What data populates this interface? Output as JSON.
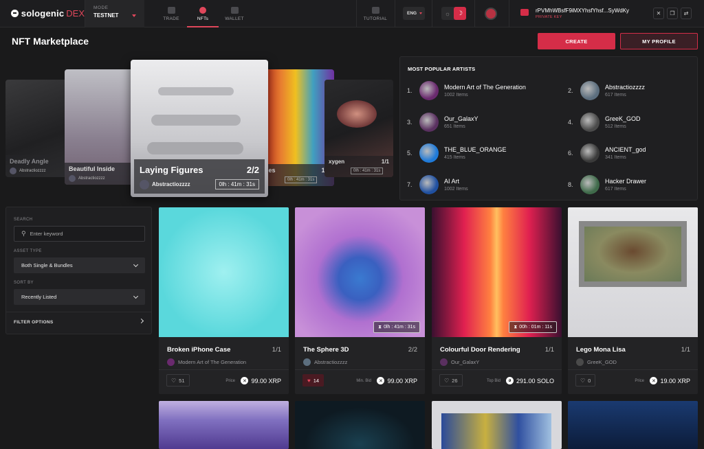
{
  "app": {
    "logo": "sologenic",
    "logo_suffix": "DEX"
  },
  "mode": {
    "label": "MODE",
    "value": "TESTNET"
  },
  "nav": {
    "trade": "TRADE",
    "nfts": "NFTs",
    "wallet": "WALLET",
    "tutorial": "TUTORIAL"
  },
  "lang": "ENG",
  "theme": {
    "light_icon": "☼",
    "dark_icon": "☽"
  },
  "account": {
    "address": "rPVMhWBsfF9iMXYhsfYhsf...SyWdKy",
    "key_type": "PRIVATE KEY"
  },
  "top_buttons": {
    "close": "✕",
    "copy": "❐",
    "swap": "⇄"
  },
  "page": {
    "title": "NFT Marketplace",
    "create": "CREATE",
    "profile": "MY PROFILE"
  },
  "carousel": [
    {
      "title": "Deadly Angle",
      "artist": "Abstractiozzzz",
      "edition": "",
      "timer": ""
    },
    {
      "title": "Beautiful Inside",
      "artist": "Abstractiozzzz",
      "edition": "",
      "timer": ""
    },
    {
      "title": "Laying Figures",
      "artist": "Abstractiozzzz",
      "edition": "2/2",
      "timer": "0lh : 41m : 31s"
    },
    {
      "title": "ies",
      "artist": "",
      "edition": "1/1",
      "timer": "0lh : 41m : 31s"
    },
    {
      "title": "xygen",
      "artist": "",
      "edition": "1/1",
      "timer": "0lh : 41m : 31s"
    }
  ],
  "artists": {
    "heading": "MOST POPULAR ARTISTS",
    "list": [
      {
        "rank": "1.",
        "name": "Modern Art of The Generation",
        "items": "1002 Items",
        "color": "#6a2a6e"
      },
      {
        "rank": "2.",
        "name": "Abstractiozzzz",
        "items": "617 Items",
        "color": "#5c6e7e"
      },
      {
        "rank": "3.",
        "name": "Our_GalaxY",
        "items": "651 Items",
        "color": "#5a3060"
      },
      {
        "rank": "4.",
        "name": "GreeK_GOD",
        "items": "512 Items",
        "color": "#4a4a4a"
      },
      {
        "rank": "5.",
        "name": "THE_BLUE_ORANGE",
        "items": "415 Items",
        "color": "#1f7ad8"
      },
      {
        "rank": "6.",
        "name": "ANCIENT_god",
        "items": "341 Items",
        "color": "#3a3a3a"
      },
      {
        "rank": "7.",
        "name": "AI Art",
        "items": "1002 Items",
        "color": "#2050a0"
      },
      {
        "rank": "8.",
        "name": "Hacker Drawer",
        "items": "617 Items",
        "color": "#3f6a4a"
      }
    ]
  },
  "filters": {
    "search_label": "SEARCH",
    "search_placeholder": "Enter keyword",
    "asset_label": "ASSET TYPE",
    "asset_value": "Both Single & Bundles",
    "sort_label": "SORT BY",
    "sort_value": "Recently Listed",
    "options_label": "FILTER OPTIONS"
  },
  "nfts": [
    {
      "title": "Broken iPhone Case",
      "edition": "1/1",
      "artist": "Modern Art of The Generation",
      "likes": "51",
      "liked": false,
      "price_label": "Price",
      "price": "99.00 XRP",
      "coin": "✕",
      "timer": ""
    },
    {
      "title": "The Sphere 3D",
      "edition": "2/2",
      "artist": "Abstractiozzzz",
      "likes": "14",
      "liked": true,
      "price_label": "Min. Bid",
      "price": "99.00 XRP",
      "coin": "✕",
      "timer": "0lh : 41m : 31s"
    },
    {
      "title": "Colourful Door Rendering",
      "edition": "1/1",
      "artist": "Our_GalaxY",
      "likes": "26",
      "liked": false,
      "price_label": "Top Bid",
      "price": "291.00 SOLO",
      "coin": "ə",
      "timer": "00h : 01m : 11s"
    },
    {
      "title": "Lego Mona Lisa",
      "edition": "1/1",
      "artist": "GreeK_GOD",
      "likes": "0",
      "liked": false,
      "price_label": "Price",
      "price": "19.00 XRP",
      "coin": "✕",
      "timer": ""
    }
  ]
}
